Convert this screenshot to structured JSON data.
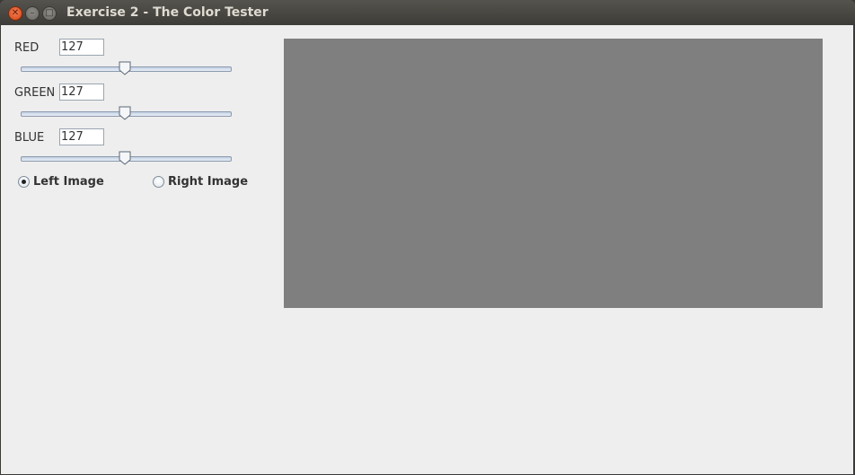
{
  "window": {
    "title": "Exercise 2 - The Color Tester"
  },
  "controls": {
    "red": {
      "label": "RED",
      "value": "127",
      "slider_value": 127,
      "slider_max": 255
    },
    "green": {
      "label": "GREEN",
      "value": "127",
      "slider_value": 127,
      "slider_max": 255
    },
    "blue": {
      "label": "BLUE",
      "value": "127",
      "slider_value": 127,
      "slider_max": 255
    }
  },
  "radios": {
    "left": {
      "label": "Left Image",
      "selected": true
    },
    "right": {
      "label": "Right Image",
      "selected": false
    }
  },
  "preview": {
    "color": "#7f7f7f"
  },
  "icons": {
    "close": "close-icon",
    "minimize": "minimize-icon",
    "maximize": "maximize-icon"
  }
}
